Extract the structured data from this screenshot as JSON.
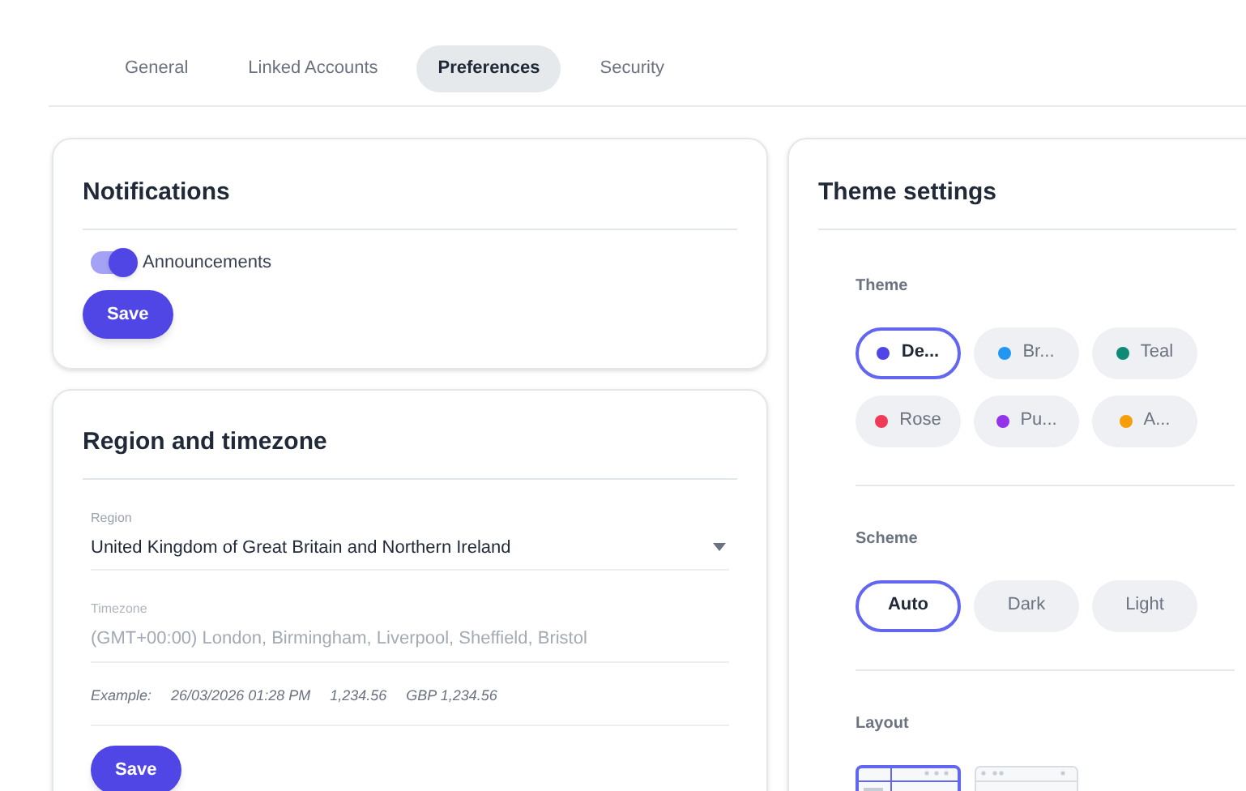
{
  "tabs": [
    {
      "label": "General",
      "selected": false
    },
    {
      "label": "Linked Accounts",
      "selected": false
    },
    {
      "label": "Preferences",
      "selected": true
    },
    {
      "label": "Security",
      "selected": false
    }
  ],
  "notifications": {
    "title": "Notifications",
    "toggles": [
      {
        "label": "Announcements",
        "on": true
      }
    ],
    "save": "Save"
  },
  "region_timezone": {
    "title": "Region and timezone",
    "region": {
      "label": "Region",
      "value": "United Kingdom of Great Britain and Northern Ireland"
    },
    "timezone": {
      "label": "Timezone",
      "value": "(GMT+00:00) London, Birmingham, Liverpool, Sheffield, Bristol",
      "disabled": true
    },
    "example": [
      "Example:",
      "26/03/2026 01:28 PM",
      "1,234.56",
      "GBP 1,234.56"
    ],
    "save": "Save"
  },
  "theme_settings": {
    "title": "Theme settings",
    "theme": {
      "label": "Theme",
      "options": [
        {
          "label": "De...",
          "color": "#4f46e5",
          "selected": true
        },
        {
          "label": "Br...",
          "color": "#2196f3",
          "selected": false
        },
        {
          "label": "Teal",
          "color": "#0f8a74",
          "selected": false
        },
        {
          "label": "Rose",
          "color": "#ef3b56",
          "selected": false
        },
        {
          "label": "Pu...",
          "color": "#9333ea",
          "selected": false
        },
        {
          "label": "A...",
          "color": "#f59e0b",
          "selected": false
        }
      ]
    },
    "scheme": {
      "label": "Scheme",
      "options": [
        {
          "label": "Auto",
          "selected": true
        },
        {
          "label": "Dark",
          "selected": false
        },
        {
          "label": "Light",
          "selected": false
        }
      ]
    },
    "layout": {
      "label": "Layout",
      "options": [
        {
          "kind": "sidebar",
          "selected": true
        },
        {
          "kind": "topbar",
          "selected": false
        }
      ]
    }
  }
}
